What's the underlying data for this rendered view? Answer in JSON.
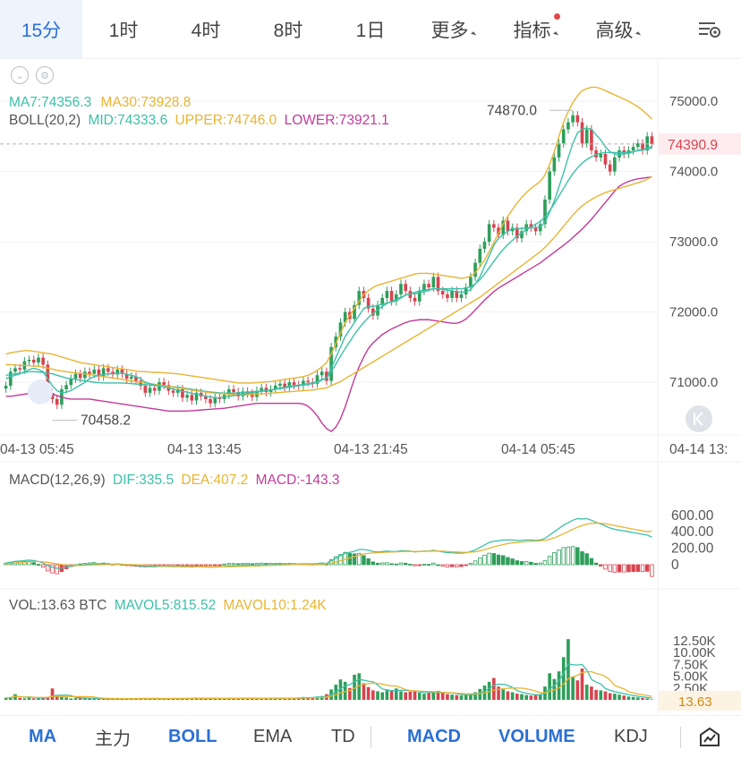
{
  "timeframes": [
    {
      "label": "15分",
      "active": true,
      "caret": false,
      "dot": false
    },
    {
      "label": "1时",
      "active": false,
      "caret": false,
      "dot": false
    },
    {
      "label": "4时",
      "active": false,
      "caret": false,
      "dot": false
    },
    {
      "label": "8时",
      "active": false,
      "caret": false,
      "dot": false
    },
    {
      "label": "1日",
      "active": false,
      "caret": false,
      "dot": false
    },
    {
      "label": "更多",
      "active": false,
      "caret": true,
      "dot": false
    },
    {
      "label": "指标",
      "active": false,
      "caret": true,
      "dot": true
    },
    {
      "label": "高级",
      "active": false,
      "caret": true,
      "dot": false
    }
  ],
  "settings_icon": "chart-settings-icon",
  "legend": {
    "ma7": "MA7:74356.3",
    "ma30": "MA30:73928.8",
    "boll_name": "BOLL(20,2)",
    "boll_mid": "MID:74333.6",
    "boll_upper": "UPPER:74746.0",
    "boll_lower": "LOWER:73921.1",
    "macd_name": "MACD(12,26,9)",
    "macd_dif": "DIF:335.5",
    "macd_dea": "DEA:407.2",
    "macd_val": "MACD:-143.3",
    "vol": "VOL:13.63 BTC",
    "mavol5": "MAVOL5:815.52",
    "mavol10": "MAVOL10:1.24K"
  },
  "colors": {
    "up": "#2f9e5b",
    "down": "#d9434f",
    "ma7": "#3cc0a8",
    "ma30": "#e8b432",
    "boll_mid": "#3cc0a8",
    "boll_upper": "#e8b432",
    "boll_lower": "#c23b9a",
    "dif": "#3cc0a8",
    "dea": "#e8b432",
    "macd": "#c23b9a",
    "active": "#2b6fd6"
  },
  "chart_data": {
    "type": "candlestick",
    "price_axis": {
      "ticks": [
        "75000.0",
        "74000.0",
        "73000.0",
        "72000.0",
        "71000.0"
      ],
      "range": [
        70250,
        75600
      ]
    },
    "time_axis": [
      "04-13 05:45",
      "04-13 13:45",
      "04-13 21:45",
      "04-14 05:45",
      "04-14 13:"
    ],
    "last_price": "74390.9",
    "high_marker": "74870.0",
    "low_marker": "70458.2",
    "close": [
      70950,
      71150,
      71200,
      71180,
      71300,
      71320,
      71280,
      71350,
      71250,
      70850,
      70760,
      70680,
      70900,
      70960,
      71050,
      71120,
      71060,
      71150,
      71120,
      71180,
      71080,
      71200,
      71150,
      71110,
      71180,
      71120,
      71050,
      71080,
      71020,
      70950,
      70850,
      70920,
      70880,
      71000,
      70960,
      70880,
      70850,
      70900,
      70780,
      70820,
      70740,
      70850,
      70800,
      70760,
      70700,
      70780,
      70760,
      70820,
      70900,
      70860,
      70800,
      70870,
      70840,
      70790,
      70880,
      70920,
      70860,
      70900,
      70950,
      70980,
      70920,
      71000,
      70960,
      70950,
      71020,
      71000,
      70980,
      71100,
      71150,
      71020,
      71500,
      71650,
      71850,
      72000,
      71900,
      72100,
      72300,
      72200,
      72050,
      71950,
      72100,
      72200,
      72300,
      72150,
      72250,
      72400,
      72300,
      72200,
      72150,
      72300,
      72400,
      72350,
      72500,
      72300,
      72250,
      72200,
      72300,
      72200,
      72250,
      72350,
      72500,
      72700,
      72900,
      73000,
      73250,
      73200,
      73100,
      73300,
      73150,
      73200,
      73050,
      73150,
      73250,
      73200,
      73150,
      73250,
      73600,
      74000,
      74200,
      74400,
      74600,
      74700,
      74800,
      74700,
      74400,
      74600,
      74300,
      74200,
      74250,
      74100,
      74000,
      74200,
      74300,
      74250,
      74300,
      74350,
      74400,
      74300,
      74500,
      74390.9
    ],
    "ma7": [
      71050,
      71080,
      71100,
      71120,
      71150,
      71180,
      71200,
      71180,
      71150,
      71050,
      70950,
      70880,
      70850,
      70860,
      70880,
      70920,
      70960,
      71000,
      71050,
      71080,
      71100,
      71110,
      71120,
      71120,
      71130,
      71130,
      71110,
      71100,
      71080,
      71050,
      71000,
      70980,
      70960,
      70950,
      70940,
      70920,
      70900,
      70890,
      70870,
      70860,
      70840,
      70830,
      70820,
      70800,
      70790,
      70780,
      70780,
      70790,
      70800,
      70810,
      70820,
      70830,
      70840,
      70850,
      70860,
      70870,
      70880,
      70890,
      70900,
      70920,
      70930,
      70940,
      70950,
      70960,
      70970,
      70980,
      70990,
      71010,
      71040,
      71060,
      71200,
      71350,
      71500,
      71650,
      71750,
      71850,
      71950,
      72050,
      72080,
      72080,
      72090,
      72110,
      72130,
      72140,
      72160,
      72200,
      72240,
      72260,
      72260,
      72270,
      72290,
      72310,
      72330,
      72330,
      72320,
      72310,
      72300,
      72290,
      72280,
      72290,
      72320,
      72400,
      72500,
      72650,
      72800,
      72950,
      73050,
      73100,
      73150,
      73180,
      73180,
      73190,
      73200,
      73200,
      73200,
      73210,
      73280,
      73420,
      73580,
      73780,
      73980,
      74200,
      74400,
      74550,
      74600,
      74620,
      74600,
      74520,
      74450,
      74350,
      74280,
      74250,
      74240,
      74250,
      74260,
      74280,
      74300,
      74310,
      74330,
      74356.3
    ],
    "ma30": [
      71250,
      71250,
      71245,
      71240,
      71240,
      71235,
      71230,
      71225,
      71215,
      71200,
      71185,
      71170,
      71160,
      71150,
      71140,
      71135,
      71125,
      71120,
      71110,
      71100,
      71090,
      71080,
      71070,
      71060,
      71050,
      71040,
      71030,
      71020,
      71010,
      71000,
      70990,
      70980,
      70970,
      70960,
      70950,
      70940,
      70930,
      70920,
      70910,
      70900,
      70890,
      70880,
      70870,
      70860,
      70850,
      70845,
      70840,
      70835,
      70830,
      70825,
      70820,
      70820,
      70820,
      70825,
      70830,
      70835,
      70840,
      70845,
      70850,
      70855,
      70860,
      70865,
      70870,
      70875,
      70880,
      70885,
      70890,
      70900,
      70910,
      70920,
      70950,
      70980,
      71010,
      71050,
      71090,
      71130,
      71170,
      71210,
      71250,
      71290,
      71330,
      71370,
      71410,
      71450,
      71490,
      71530,
      71570,
      71610,
      71650,
      71690,
      71730,
      71770,
      71810,
      71850,
      71890,
      71930,
      71970,
      72010,
      72050,
      72090,
      72130,
      72170,
      72210,
      72260,
      72310,
      72360,
      72410,
      72460,
      72510,
      72560,
      72610,
      72660,
      72710,
      72760,
      72810,
      72860,
      72920,
      72990,
      73060,
      73140,
      73220,
      73300,
      73380,
      73450,
      73510,
      73560,
      73600,
      73640,
      73670,
      73700,
      73720,
      73740,
      73760,
      73780,
      73800,
      73820,
      73840,
      73860,
      73890,
      73928.8
    ],
    "boll_upper": [
      71400,
      71420,
      71430,
      71440,
      71450,
      71450,
      71440,
      71430,
      71420,
      71410,
      71400,
      71380,
      71360,
      71340,
      71320,
      71300,
      71280,
      71270,
      71260,
      71250,
      71240,
      71230,
      71220,
      71210,
      71200,
      71190,
      71180,
      71170,
      71160,
      71150,
      71150,
      71145,
      71140,
      71140,
      71135,
      71130,
      71125,
      71120,
      71110,
      71100,
      71090,
      71080,
      71070,
      71060,
      71050,
      71040,
      71030,
      71020,
      71010,
      71000,
      70990,
      70990,
      70990,
      70990,
      70995,
      71000,
      71005,
      71010,
      71020,
      71030,
      71040,
      71050,
      71060,
      71070,
      71080,
      71100,
      71130,
      71170,
      71220,
      71280,
      71400,
      71550,
      71700,
      71850,
      71950,
      72050,
      72150,
      72250,
      72300,
      72350,
      72380,
      72400,
      72420,
      72440,
      72460,
      72480,
      72500,
      72520,
      72540,
      72550,
      72550,
      72550,
      72540,
      72530,
      72520,
      72510,
      72500,
      72490,
      72480,
      72490,
      72510,
      72560,
      72640,
      72740,
      72860,
      72990,
      73120,
      73250,
      73360,
      73460,
      73550,
      73630,
      73700,
      73760,
      73810,
      73860,
      73950,
      74100,
      74280,
      74500,
      74700,
      74850,
      74980,
      75080,
      75150,
      75180,
      75200,
      75200,
      75180,
      75150,
      75120,
      75090,
      75060,
      75030,
      75000,
      74960,
      74920,
      74870,
      74810,
      74746.0
    ],
    "boll_mid": [
      71100,
      71110,
      71120,
      71130,
      71140,
      71150,
      71150,
      71145,
      71140,
      71130,
      71120,
      71100,
      71080,
      71060,
      71050,
      71040,
      71030,
      71020,
      71010,
      71000,
      70995,
      70990,
      70990,
      70990,
      70990,
      70990,
      70985,
      70980,
      70975,
      70970,
      70965,
      70960,
      70955,
      70950,
      70945,
      70940,
      70935,
      70930,
      70920,
      70910,
      70900,
      70890,
      70880,
      70870,
      70860,
      70855,
      70850,
      70845,
      70845,
      70845,
      70850,
      70855,
      70860,
      70865,
      70870,
      70875,
      70880,
      70890,
      70900,
      70910,
      70920,
      70930,
      70940,
      70950,
      70960,
      70970,
      70980,
      71000,
      71030,
      71060,
      71150,
      71260,
      71370,
      71480,
      71580,
      71680,
      71770,
      71850,
      71920,
      71980,
      72030,
      72080,
      72120,
      72150,
      72180,
      72210,
      72240,
      72260,
      72280,
      72300,
      72310,
      72320,
      72330,
      72330,
      72330,
      72330,
      72330,
      72330,
      72330,
      72340,
      72360,
      72400,
      72460,
      72540,
      72630,
      72720,
      72810,
      72890,
      72960,
      73020,
      73080,
      73130,
      73170,
      73210,
      73250,
      73290,
      73350,
      73440,
      73540,
      73650,
      73760,
      73870,
      73970,
      74050,
      74120,
      74170,
      74210,
      74240,
      74260,
      74270,
      74270,
      74270,
      74270,
      74270,
      74275,
      74285,
      74295,
      74305,
      74320,
      74333.6
    ],
    "boll_lower": [
      70800,
      70800,
      70810,
      70820,
      70830,
      70840,
      70850,
      70850,
      70850,
      70840,
      70830,
      70810,
      70790,
      70770,
      70760,
      70760,
      70760,
      70760,
      70760,
      70750,
      70740,
      70730,
      70720,
      70710,
      70700,
      70690,
      70680,
      70670,
      70660,
      70650,
      70640,
      70630,
      70620,
      70610,
      70600,
      70590,
      70590,
      70590,
      70590,
      70590,
      70595,
      70600,
      70605,
      70610,
      70615,
      70620,
      70625,
      70630,
      70640,
      70650,
      70660,
      70670,
      70680,
      70690,
      70700,
      70700,
      70700,
      70700,
      70700,
      70700,
      70700,
      70700,
      70700,
      70700,
      70690,
      70660,
      70600,
      70520,
      70420,
      70340,
      70300,
      70360,
      70480,
      70650,
      70850,
      71050,
      71220,
      71360,
      71480,
      71560,
      71620,
      71680,
      71720,
      71760,
      71790,
      71820,
      71850,
      71870,
      71880,
      71890,
      71890,
      71890,
      71880,
      71870,
      71860,
      71850,
      71840,
      71840,
      71860,
      71900,
      71960,
      72030,
      72100,
      72170,
      72230,
      72290,
      72340,
      72380,
      72420,
      72460,
      72500,
      72540,
      72580,
      72620,
      72660,
      72700,
      72750,
      72800,
      72850,
      72900,
      72950,
      73000,
      73060,
      73120,
      73180,
      73250,
      73320,
      73400,
      73480,
      73560,
      73640,
      73720,
      73790,
      73830,
      73860,
      73880,
      73895,
      73905,
      73915,
      73921.1
    ],
    "macd_axis": [
      "600.00",
      "400.00",
      "200.00",
      "0"
    ],
    "dif": [
      20,
      30,
      40,
      45,
      50,
      55,
      50,
      40,
      20,
      -10,
      -30,
      -45,
      -40,
      -30,
      -20,
      -10,
      -5,
      0,
      5,
      10,
      5,
      10,
      8,
      5,
      8,
      5,
      0,
      -5,
      -10,
      -15,
      -20,
      -22,
      -24,
      -20,
      -20,
      -22,
      -24,
      -22,
      -26,
      -25,
      -28,
      -25,
      -26,
      -28,
      -30,
      -28,
      -27,
      -22,
      -18,
      -16,
      -16,
      -12,
      -10,
      -10,
      -6,
      -2,
      -2,
      0,
      2,
      5,
      5,
      8,
      8,
      8,
      10,
      10,
      10,
      15,
      20,
      15,
      50,
      80,
      110,
      140,
      150,
      165,
      185,
      185,
      175,
      160,
      155,
      160,
      165,
      160,
      160,
      170,
      170,
      165,
      155,
      160,
      165,
      165,
      175,
      165,
      155,
      145,
      145,
      140,
      140,
      145,
      160,
      180,
      210,
      240,
      270,
      285,
      290,
      300,
      300,
      300,
      295,
      295,
      300,
      300,
      295,
      300,
      320,
      360,
      400,
      440,
      480,
      510,
      540,
      560,
      555,
      560,
      540,
      515,
      495,
      470,
      445,
      430,
      420,
      410,
      400,
      390,
      380,
      370,
      360,
      335.5
    ],
    "dea": [
      10,
      15,
      20,
      25,
      30,
      35,
      38,
      38,
      35,
      28,
      20,
      10,
      2,
      -5,
      -8,
      -10,
      -10,
      -8,
      -6,
      -3,
      -2,
      0,
      1,
      2,
      3,
      3,
      3,
      2,
      0,
      -3,
      -6,
      -9,
      -12,
      -13,
      -14,
      -16,
      -17,
      -18,
      -20,
      -21,
      -22,
      -23,
      -24,
      -25,
      -26,
      -26,
      -26,
      -26,
      -25,
      -23,
      -22,
      -20,
      -18,
      -16,
      -14,
      -12,
      -10,
      -8,
      -6,
      -4,
      -2,
      0,
      1,
      3,
      4,
      5,
      6,
      8,
      10,
      11,
      19,
      31,
      47,
      65,
      82,
      99,
      116,
      130,
      139,
      143,
      146,
      149,
      153,
      154,
      156,
      159,
      161,
      162,
      161,
      161,
      162,
      163,
      165,
      165,
      164,
      160,
      157,
      154,
      151,
      150,
      152,
      157,
      168,
      182,
      200,
      217,
      231,
      245,
      256,
      265,
      271,
      276,
      281,
      285,
      287,
      290,
      296,
      309,
      327,
      350,
      376,
      403,
      430,
      456,
      476,
      493,
      502,
      505,
      503,
      497,
      487,
      476,
      464,
      454,
      443,
      432,
      421,
      411,
      400,
      407.2
    ],
    "macd": [
      20,
      30,
      40,
      40,
      40,
      40,
      24,
      4,
      -30,
      -76,
      -100,
      -110,
      -84,
      -50,
      -24,
      0,
      10,
      16,
      22,
      26,
      14,
      20,
      14,
      6,
      10,
      4,
      -6,
      -14,
      -20,
      -24,
      -28,
      -26,
      -24,
      -14,
      -12,
      -12,
      -14,
      -8,
      -12,
      -8,
      -12,
      -4,
      -4,
      -6,
      -8,
      -4,
      -2,
      8,
      14,
      14,
      12,
      16,
      16,
      12,
      16,
      20,
      16,
      16,
      16,
      18,
      14,
      16,
      14,
      10,
      12,
      10,
      8,
      14,
      20,
      8,
      62,
      98,
      126,
      150,
      136,
      132,
      138,
      110,
      72,
      34,
      18,
      22,
      24,
      12,
      8,
      22,
      18,
      6,
      -12,
      -2,
      6,
      4,
      20,
      0,
      -18,
      -30,
      -24,
      -28,
      -22,
      -10,
      16,
      46,
      84,
      116,
      140,
      136,
      118,
      110,
      88,
      70,
      48,
      38,
      38,
      30,
      16,
      20,
      48,
      102,
      146,
      180,
      208,
      214,
      220,
      208,
      158,
      134,
      76,
      20,
      -16,
      -54,
      -84,
      -92,
      -88,
      -88,
      -86,
      -84,
      -82,
      -82,
      -80,
      -143.3
    ],
    "vol_axis": [
      "12.50K",
      "10.00K",
      "7.50K",
      "5.00K",
      "2.50K"
    ],
    "last_vol": "13.63",
    "volume": [
      400,
      600,
      1200,
      400,
      300,
      500,
      300,
      400,
      500,
      600,
      2400,
      800,
      600,
      500,
      300,
      350,
      400,
      300,
      300,
      200,
      300,
      200,
      250,
      300,
      200,
      250,
      300,
      250,
      300,
      350,
      300,
      250,
      300,
      200,
      250,
      300,
      350,
      300,
      250,
      300,
      350,
      400,
      300,
      250,
      300,
      350,
      300,
      250,
      300,
      350,
      400,
      350,
      300,
      250,
      300,
      350,
      300,
      350,
      400,
      300,
      300,
      350,
      400,
      500,
      600,
      500,
      450,
      700,
      800,
      1200,
      2200,
      3200,
      4300,
      3800,
      2500,
      5300,
      5600,
      3500,
      2700,
      2000,
      1800,
      1600,
      2200,
      2000,
      2400,
      1800,
      1600,
      1700,
      1800,
      1500,
      1300,
      1400,
      1600,
      1900,
      1400,
      1200,
      1100,
      1000,
      900,
      1000,
      1200,
      1600,
      2300,
      3000,
      3800,
      4600,
      2800,
      2200,
      1800,
      1600,
      1300,
      1200,
      1000,
      900,
      1000,
      1200,
      2800,
      5600,
      4400,
      6000,
      9000,
      12800,
      4800,
      4100,
      6600,
      3200,
      2800,
      2100,
      2000,
      1800,
      1400,
      1300,
      1100,
      900,
      700,
      600,
      500,
      400,
      300,
      100
    ]
  },
  "bottom_tabs": [
    {
      "label": "MA",
      "active": true
    },
    {
      "label": "主力",
      "active": false
    },
    {
      "label": "BOLL",
      "active": true
    },
    {
      "label": "EMA",
      "active": false
    },
    {
      "label": "TD",
      "active": false
    },
    {
      "label": "MACD",
      "active": true
    },
    {
      "label": "VOLUME",
      "active": true
    },
    {
      "label": "KDJ",
      "active": false
    }
  ],
  "bottom_right_icon": "chart-draw-icon"
}
